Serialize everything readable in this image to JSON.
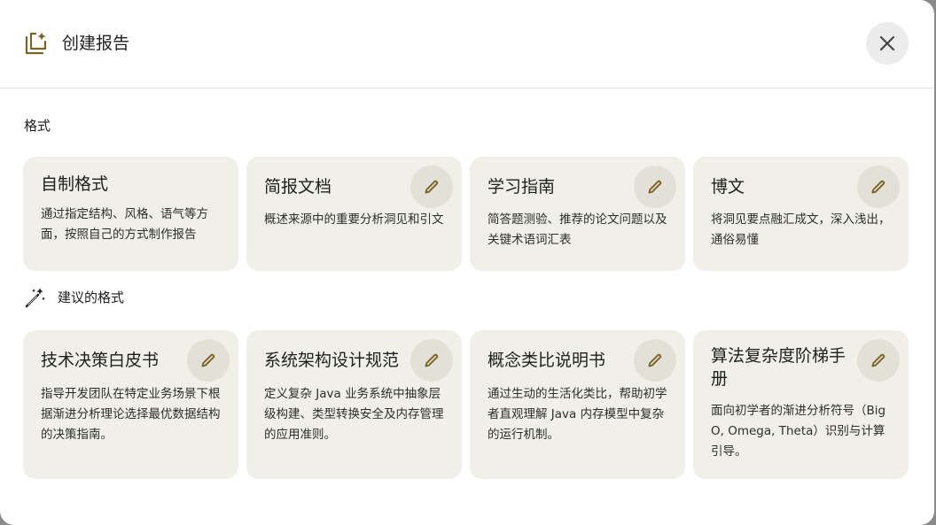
{
  "dialog": {
    "title": "创建报告",
    "header_icon": "report-sparkle-icon",
    "close_icon": "close-icon"
  },
  "sections": {
    "format_label": "格式",
    "suggested_label": "建议的格式",
    "suggested_icon": "magic-wand-icon"
  },
  "format_cards": [
    {
      "title": "自制格式",
      "description": "通过指定结构、风格、语气等方面，按照自己的方式制作报告",
      "editable": false
    },
    {
      "title": "简报文档",
      "description": "概述来源中的重要分析洞见和引文",
      "editable": true
    },
    {
      "title": "学习指南",
      "description": "简答题测验、推荐的论文问题以及关键术语词汇表",
      "editable": true
    },
    {
      "title": "博文",
      "description": "将洞见要点融汇成文，深入浅出，通俗易懂",
      "editable": true
    }
  ],
  "suggested_cards": [
    {
      "title": "技术决策白皮书",
      "description": "指导开发团队在特定业务场景下根据渐进分析理论选择最优数据结构的决策指南。",
      "editable": true
    },
    {
      "title": "系统架构设计规范",
      "description": "定义复杂 Java 业务系统中抽象层级构建、类型转换安全及内存管理的应用准则。",
      "editable": true
    },
    {
      "title": "概念类比说明书",
      "description": "通过生动的生活化类比，帮助初学者直观理解 Java 内存模型中复杂的运行机制。",
      "editable": true
    },
    {
      "title": "算法复杂度阶梯手册",
      "description": "面向初学者的渐进分析符号（Big O, Omega, Theta）识别与计算引导。",
      "editable": true
    }
  ],
  "edit_icon": "pencil-icon",
  "colors": {
    "accent": "#7a6425",
    "card_bg": "#f1f0e8",
    "edit_btn_bg": "#e3e1d7",
    "close_btn_bg": "#ececec"
  }
}
